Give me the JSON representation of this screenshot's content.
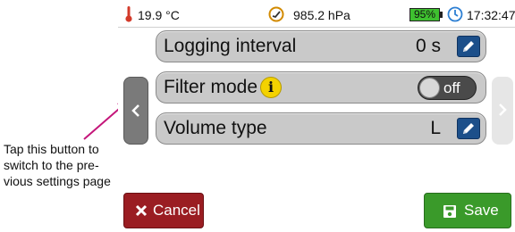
{
  "status": {
    "temperature": "19.9 °C",
    "pressure": "985.2 hPa",
    "battery": "95%",
    "time": "17:32:47"
  },
  "settings": [
    {
      "label": "Logging interval",
      "value": "0 s"
    },
    {
      "label": "Filter mode",
      "toggle": "off"
    },
    {
      "label": "Volume type",
      "value": "L"
    }
  ],
  "buttons": {
    "cancel": "Cancel",
    "save": "Save"
  },
  "annotation": "Tap this button to switch to the pre-vious settings page",
  "colors": {
    "accent_arrow": "#c4167a",
    "cancel": "#9a1d22",
    "save": "#3a9a2a",
    "battery": "#3ec02f",
    "edit": "#1c4f8a",
    "info": "#f3d200",
    "clock_icon": "#2d7fd3",
    "pressure_icon": "#d28a00",
    "temp_icon": "#d33a2a"
  }
}
